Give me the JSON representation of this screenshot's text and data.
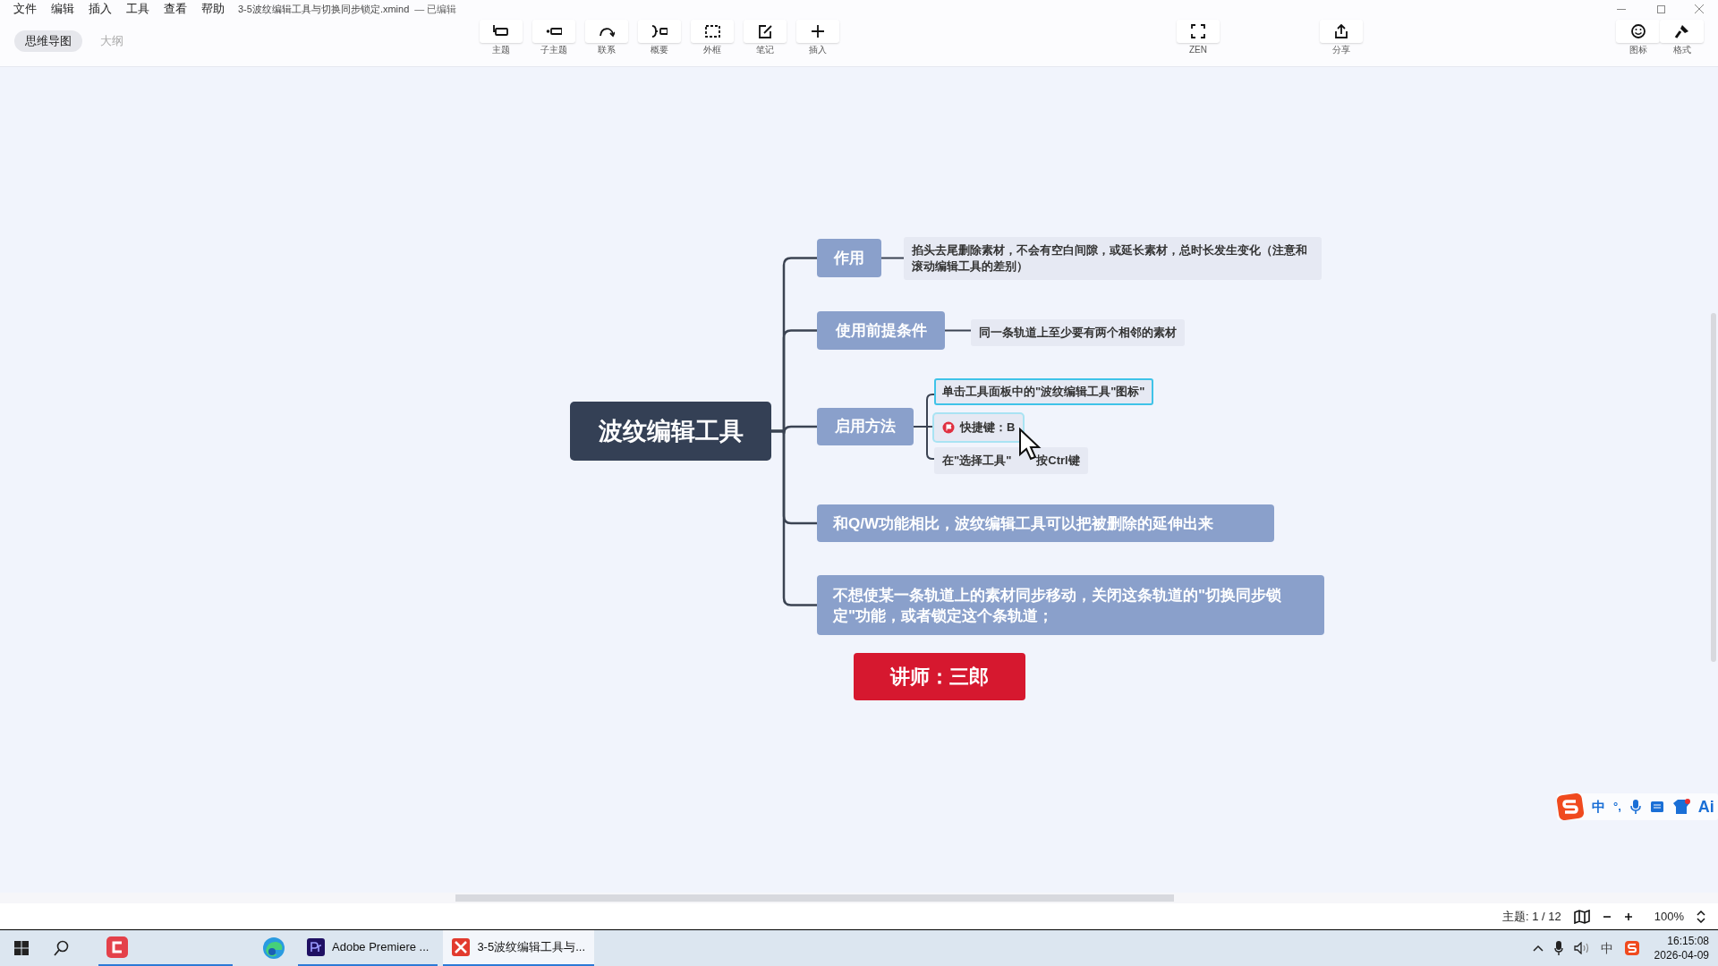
{
  "menu": [
    "文件",
    "编辑",
    "插入",
    "工具",
    "查看",
    "帮助"
  ],
  "document_title": "3-5波纹编辑工具与切换同步锁定.xmind",
  "edit_state": "— 已编辑",
  "view_tabs": [
    {
      "label": "思维导图",
      "selected": true
    },
    {
      "label": "大纲",
      "selected": false
    }
  ],
  "toolbar": [
    {
      "label": "主题",
      "kind": "topic"
    },
    {
      "label": "子主题",
      "kind": "subtopic"
    },
    {
      "label": "联系",
      "kind": "relation"
    },
    {
      "label": "概要",
      "kind": "summary"
    },
    {
      "label": "外框",
      "kind": "boundary"
    },
    {
      "label": "笔记",
      "kind": "note"
    },
    {
      "label": "插入",
      "kind": "insert"
    }
  ],
  "zen_button": {
    "label": "ZEN"
  },
  "share_button": {
    "label": "分享"
  },
  "side_panel_buttons": [
    {
      "label": "图标",
      "kind": "sticker"
    },
    {
      "label": "格式",
      "kind": "format"
    }
  ],
  "mind_map": {
    "central": "波纹编辑工具",
    "branches": [
      {
        "label": "作用",
        "kind": "short",
        "details": [
          {
            "text": "掐头去尾删除素材，不会有空白间隙，或延长素材，总时长发生变化（注意和滚动编辑工具的差别）",
            "selected": false,
            "hovered": false,
            "flag": false
          }
        ]
      },
      {
        "label": "使用前提条件",
        "kind": "short",
        "details": [
          {
            "text": "同一条轨道上至少要有两个相邻的素材",
            "selected": false,
            "hovered": false,
            "flag": false
          }
        ]
      },
      {
        "label": "启用方法",
        "kind": "short",
        "details": [
          {
            "text": "单击工具面板中的\"波纹编辑工具\"图标\"",
            "selected": true,
            "hovered": false,
            "flag": false
          },
          {
            "text": "快捷键：B",
            "selected": false,
            "hovered": true,
            "flag": true
          },
          {
            "text": "在\"选择工具\"",
            "text_after": "按Ctrl键",
            "selected": false,
            "hovered": false,
            "flag": false
          }
        ]
      },
      {
        "label": "和Q/W功能相比，波纹编辑工具可以把被删除的延伸出来",
        "kind": "wide"
      },
      {
        "label": "不想使某一条轨道上的素材同步移动，关闭这条轨道的\"切换同步锁定\"功能，或者锁定这个条轨道；",
        "kind": "wide"
      }
    ],
    "callout": "讲师：三郎"
  },
  "ime_toolbar": {
    "mode": "中",
    "punctuation": "°,",
    "ai": "Ai"
  },
  "status_bar": {
    "topic_count": "主题: 1 / 12",
    "zoom": "100%"
  },
  "taskbar": {
    "apps": [
      {
        "label": "Adobe Premiere ...",
        "kind": "premiere",
        "active": false
      },
      {
        "label": "3-5波纹编辑工具与...",
        "kind": "xmind",
        "active": true
      }
    ],
    "tray_ime": "中",
    "time": "16:15:08",
    "date": "2026-04-09"
  }
}
